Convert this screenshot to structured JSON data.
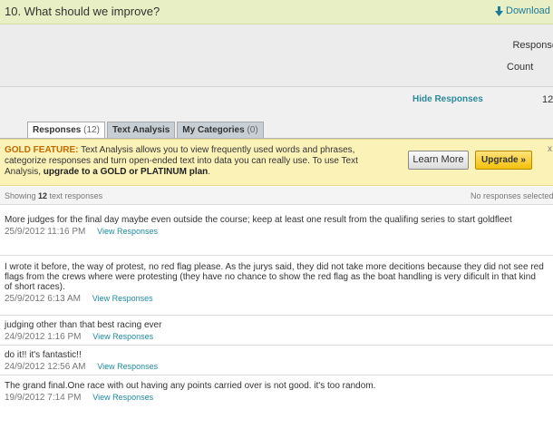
{
  "question": {
    "title": "10. What should we improve?",
    "download_label": "Download"
  },
  "stats": {
    "label_line1": "Response",
    "label_line2": "Count",
    "hide_responses_label": "Hide Responses",
    "count_value": "12"
  },
  "tabs": [
    {
      "label": "Responses",
      "count": "(12)",
      "active": true
    },
    {
      "label": "Text Analysis",
      "count": "",
      "active": false
    },
    {
      "label": "My Categories",
      "count": "(0)",
      "active": false
    }
  ],
  "gold_banner": {
    "feature_label": "GOLD FEATURE:",
    "text": " Text Analysis allows you to view frequently used words and phrases, categorize responses and turn open-ended text into data you can really use. To use Text Analysis, ",
    "upgrade_text": "upgrade to a GOLD or PLATINUM plan",
    "end": ".",
    "learn_more_label": "Learn More",
    "upgrade_label": "Upgrade »",
    "close_label": "x"
  },
  "showing": {
    "prefix": "Showing ",
    "count": "12",
    "suffix": " text responses",
    "selected_status": "No responses selected"
  },
  "responses": [
    {
      "text": "More judges for the final day maybe even outside the course; keep at least one result from the qualifing series to start goldfleet",
      "date": "25/9/2012 11:16 PM",
      "link": "View Responses"
    },
    {
      "text": "I wrote it before, the way of protest, no red flag please. As the jurys said, they did not take more decitions because they did not see red flags from the crews where were protesting (they have no chance to show the red flag as the boat handling is very dificult in that kind of short races).",
      "date": "25/9/2012 6:13 AM",
      "link": "View Responses"
    },
    {
      "text": "judging other than that best racing ever",
      "date": "24/9/2012 1:16 PM",
      "link": "View Responses"
    },
    {
      "text": "do it!! it's fantastic!!",
      "date": "24/9/2012 12:56 AM",
      "link": "View Responses"
    },
    {
      "text": "The grand final.One race with out having any points carried over is not good. it's too random.",
      "date": "19/9/2012 7:14 PM",
      "link": "View Responses"
    }
  ],
  "colors": {
    "header_bg": "#e8efc4",
    "link_teal": "#1f8aa0",
    "gold_feature": "#c56a00",
    "banner_bg": "#fbf2b8",
    "upgrade_btn": "#f3c00c"
  },
  "icons": {
    "download": "download-arrow-icon"
  }
}
